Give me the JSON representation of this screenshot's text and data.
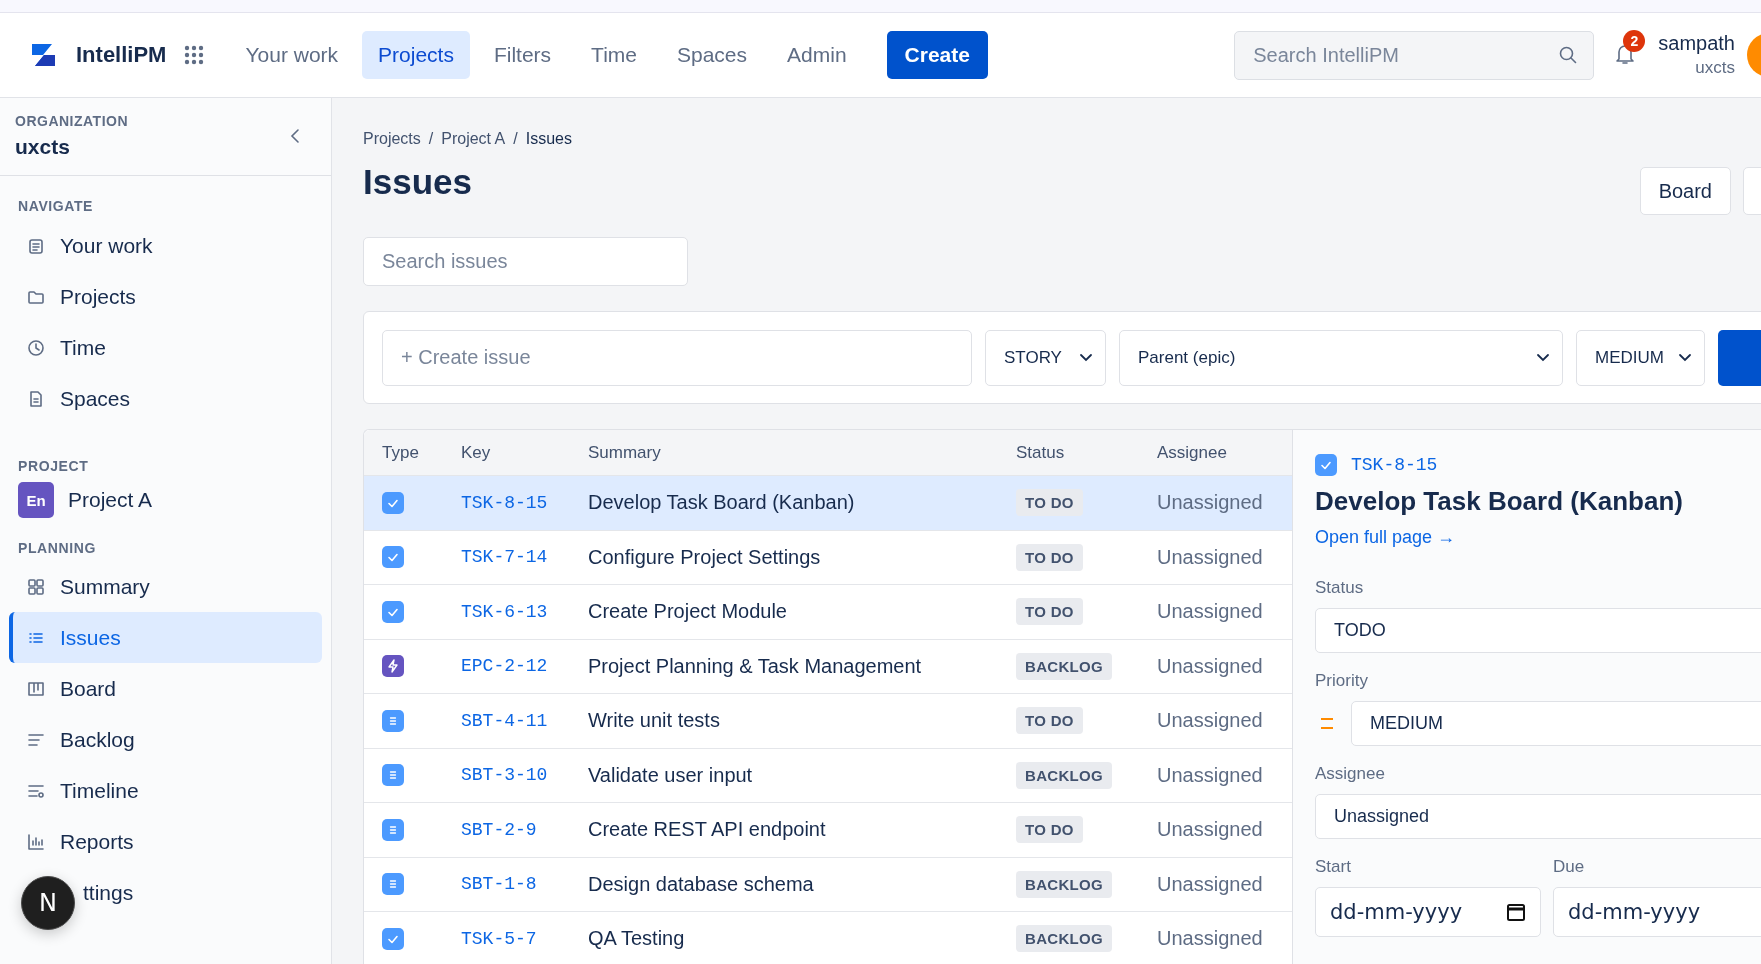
{
  "header": {
    "logo_text": "IntelliPM",
    "nav": [
      {
        "label": "Your work",
        "selected": false
      },
      {
        "label": "Projects",
        "selected": true
      },
      {
        "label": "Filters",
        "selected": false
      },
      {
        "label": "Time",
        "selected": false
      },
      {
        "label": "Spaces",
        "selected": false
      },
      {
        "label": "Admin",
        "selected": false
      }
    ],
    "create_button": "Create",
    "search": {
      "placeholder": "Search IntelliPM"
    },
    "notification_count": "2",
    "user": {
      "name": "sampath",
      "org": "uxcts"
    }
  },
  "sidebar": {
    "org_label": "ORGANIZATION",
    "org_name": "uxcts",
    "navigate": {
      "title": "NAVIGATE",
      "items": [
        {
          "label": "Your work",
          "kind": "clipboard",
          "selected": false
        },
        {
          "label": "Projects",
          "kind": "folder",
          "selected": false
        },
        {
          "label": "Time",
          "kind": "clock",
          "selected": false
        },
        {
          "label": "Spaces",
          "kind": "document",
          "selected": false
        }
      ]
    },
    "project": {
      "title": "PROJECT",
      "avatar": "En",
      "name": "Project A"
    },
    "planning": {
      "title": "PLANNING",
      "items": [
        {
          "label": "Summary",
          "kind": "grid",
          "selected": false
        },
        {
          "label": "Issues",
          "kind": "list",
          "selected": true
        },
        {
          "label": "Board",
          "kind": "board",
          "selected": false
        },
        {
          "label": "Backlog",
          "kind": "lines",
          "selected": false
        },
        {
          "label": "Timeline",
          "kind": "timeline",
          "selected": false
        },
        {
          "label": "Reports",
          "kind": "chart",
          "selected": false
        },
        {
          "label": "ttings",
          "kind": "hidden",
          "selected": false
        }
      ]
    },
    "dev_button": "N"
  },
  "page": {
    "breadcrumb": [
      "Projects",
      "Project A",
      "Issues"
    ],
    "breadcrumb_separator": "/",
    "title": "Issues",
    "view_buttons": [
      {
        "label": "Board"
      },
      {
        "kind": "cut"
      }
    ],
    "search": {
      "placeholder": "Search issues"
    },
    "create_bar": {
      "placeholder": "+ Create issue",
      "selects": [
        "STORY",
        "Parent (epic)",
        "MEDIUM"
      ],
      "submit": {
        "kind": "primary"
      }
    }
  },
  "table": {
    "columns": [
      "Type",
      "Key",
      "Summary",
      "Status",
      "Assignee"
    ],
    "rows": [
      {
        "kind": "task",
        "key": "TSK-8-15",
        "summary": "Develop Task Board (Kanban)",
        "status": "TO DO",
        "assignee": "Unassigned",
        "selected": true
      },
      {
        "kind": "task",
        "key": "TSK-7-14",
        "summary": "Configure Project Settings",
        "status": "TO DO",
        "assignee": "Unassigned",
        "selected": false
      },
      {
        "kind": "task",
        "key": "TSK-6-13",
        "summary": "Create Project Module",
        "status": "TO DO",
        "assignee": "Unassigned",
        "selected": false
      },
      {
        "kind": "epic",
        "key": "EPC-2-12",
        "summary": "Project Planning & Task Management",
        "status": "BACKLOG",
        "assignee": "Unassigned",
        "selected": false
      },
      {
        "kind": "subtask",
        "key": "SBT-4-11",
        "summary": "Write unit tests",
        "status": "TO DO",
        "assignee": "Unassigned",
        "selected": false
      },
      {
        "kind": "subtask",
        "key": "SBT-3-10",
        "summary": "Validate user input",
        "status": "BACKLOG",
        "assignee": "Unassigned",
        "selected": false
      },
      {
        "kind": "subtask",
        "key": "SBT-2-9",
        "summary": "Create REST API endpoint",
        "status": "TO DO",
        "assignee": "Unassigned",
        "selected": false
      },
      {
        "kind": "subtask",
        "key": "SBT-1-8",
        "summary": "Design database schema",
        "status": "BACKLOG",
        "assignee": "Unassigned",
        "selected": false
      },
      {
        "kind": "task",
        "key": "TSK-5-7",
        "summary": "QA Testing",
        "status": "BACKLOG",
        "assignee": "Unassigned",
        "selected": false
      }
    ]
  },
  "detail": {
    "kind": "task",
    "key": "TSK-8-15",
    "title": "Develop Task Board (Kanban)",
    "link": "Open full page →",
    "status": {
      "label": "Status",
      "value": "TODO"
    },
    "priority": {
      "label": "Priority",
      "value": "MEDIUM"
    },
    "assignee": {
      "label": "Assignee",
      "value": "Unassigned"
    },
    "start": {
      "label": "Start",
      "value": "dd-mm-yyyy"
    },
    "due": {
      "label": "Due",
      "value": "dd-mm-yyyy"
    }
  }
}
